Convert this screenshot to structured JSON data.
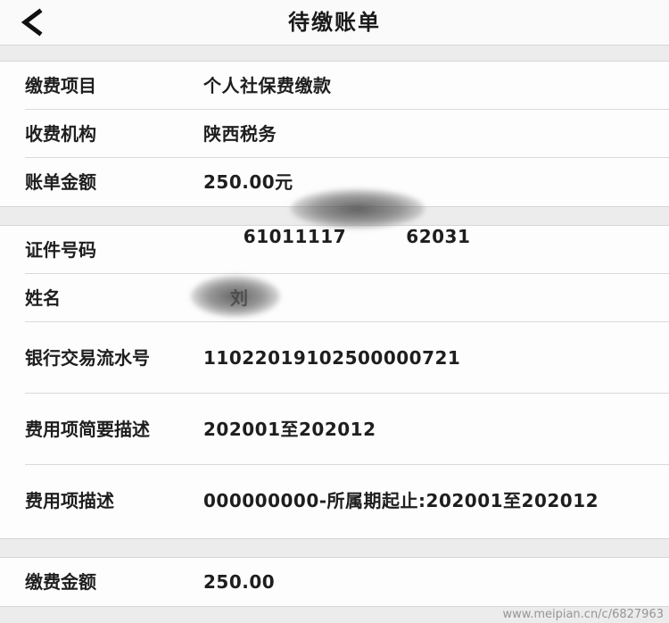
{
  "header": {
    "title": "待缴账单"
  },
  "bill_info": [
    {
      "label": "缴费项目",
      "value": "个人社保费缴款"
    },
    {
      "label": "收费机构",
      "value": "陕西税务"
    },
    {
      "label": "账单金额",
      "value": "250.00元"
    }
  ],
  "person_info": {
    "id_number": {
      "label": "证件号码",
      "value": "61011117         62031"
    },
    "name": {
      "label": "姓名",
      "value": "刘"
    },
    "serial": {
      "label": "银行交易流水号",
      "value": "11022019102500000721"
    },
    "brief_desc": {
      "label": "费用项简要描述",
      "value": "202001至202012"
    },
    "desc": {
      "label": "费用项描述",
      "value": "000000000-所属期起止:202001至202012"
    }
  },
  "payment": {
    "label": "缴费金额",
    "value": "250.00"
  },
  "watermark": "www.meipian.cn/c/6827963"
}
